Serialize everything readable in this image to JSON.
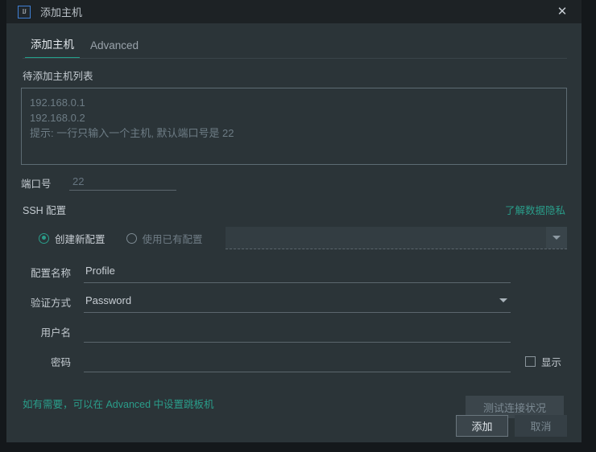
{
  "window": {
    "title": "添加主机",
    "app_icon": "intellij-idea-icon",
    "close_icon": "close-icon"
  },
  "tabs": [
    {
      "label": "添加主机",
      "active": true
    },
    {
      "label": "Advanced",
      "active": false
    }
  ],
  "host_list": {
    "label": "待添加主机列表",
    "placeholder_lines": [
      "192.168.0.1",
      "192.168.0.2",
      "提示: 一行只输入一个主机, 默认端口号是 22"
    ],
    "value": ""
  },
  "port": {
    "label": "端口号",
    "placeholder": "22",
    "value": ""
  },
  "ssh": {
    "title": "SSH 配置",
    "privacy_link": "了解数据隐私",
    "mode_new": {
      "label": "创建新配置",
      "selected": true
    },
    "mode_existing": {
      "label": "使用已有配置",
      "selected": false,
      "disabled": true
    },
    "existing_combo": {
      "value": "",
      "icon": "chevron-down-icon",
      "disabled": true
    },
    "fields": {
      "profile_name": {
        "label": "配置名称",
        "value": "Profile",
        "placeholder": ""
      },
      "auth_method": {
        "label": "验证方式",
        "value": "Password",
        "icon": "chevron-down-icon",
        "options": [
          "Password"
        ]
      },
      "username": {
        "label": "用户名",
        "value": "",
        "placeholder": ""
      },
      "password": {
        "label": "密码",
        "value": "",
        "placeholder": ""
      }
    },
    "show_password": {
      "label": "显示",
      "checked": false
    },
    "test_button": {
      "label": "测试连接状况",
      "disabled": true
    }
  },
  "footer": {
    "hint": "如有需要，可以在 Advanced 中设置跳板机",
    "add_button": "添加",
    "cancel_button": "取消"
  },
  "colors": {
    "accent": "#2a9d8a",
    "dialog_bg": "#2b3438",
    "titlebar_bg": "#1d2225",
    "text_primary": "#c8ced4",
    "text_muted": "#6d7c85",
    "icon_border": "#3f7fd4"
  }
}
